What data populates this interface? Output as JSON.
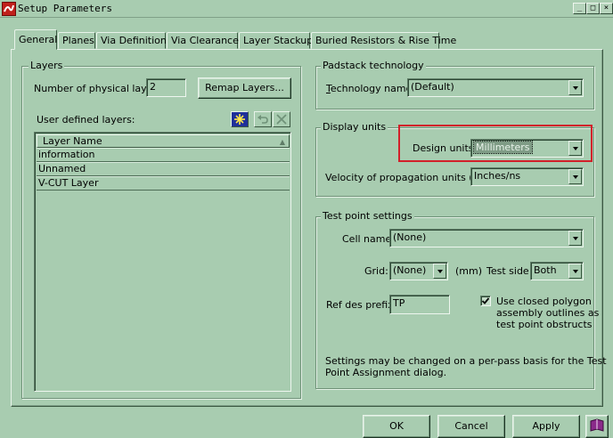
{
  "window": {
    "title": "Setup Parameters",
    "controls": [
      "_",
      "□",
      "×"
    ]
  },
  "tabs": [
    {
      "label": "General",
      "active": true
    },
    {
      "label": "Planes"
    },
    {
      "label": "Via Definitions"
    },
    {
      "label": "Via Clearances"
    },
    {
      "label": "Layer Stackup"
    },
    {
      "label": "Buried Resistors & Rise Time"
    }
  ],
  "layers": {
    "group_title": "Layers",
    "num_label": "Number of physical layers:",
    "num_value": "2",
    "remap_button": "Remap Layers...",
    "user_defined_label": "User defined layers:",
    "column_header": "Layer Name",
    "rows": [
      "information",
      "Unnamed",
      "V-CUT Layer"
    ]
  },
  "padstack": {
    "group_title": "Padstack technology",
    "tech_label": "Technology name:",
    "tech_value": "(Default)"
  },
  "display_units": {
    "group_title": "Display units",
    "design_units_label": "Design units:",
    "design_units_value": "Millimeters",
    "velocity_label": "Velocity of propagation units (Vp):",
    "velocity_value": "Inches/ns",
    "highlight_color": "#d2202a"
  },
  "test_point": {
    "group_title": "Test point settings",
    "cell_label": "Cell name:",
    "cell_value": "(None)",
    "grid_label": "Grid:",
    "grid_value": "(None)",
    "grid_unit": "(mm)",
    "side_label": "Test side:",
    "side_value": "Both",
    "refdes_label": "Ref des prefix:",
    "refdes_value": "TP",
    "polygon_checked": true,
    "polygon_label_1": "Use closed polygon",
    "polygon_label_2": "assembly outlines as",
    "polygon_label_3": "test point obstructs",
    "note_1": "Settings may be changed on a per-pass basis for the Test",
    "note_2": "Point Assignment dialog."
  },
  "buttons": {
    "ok": "OK",
    "cancel": "Cancel",
    "apply": "Apply"
  }
}
